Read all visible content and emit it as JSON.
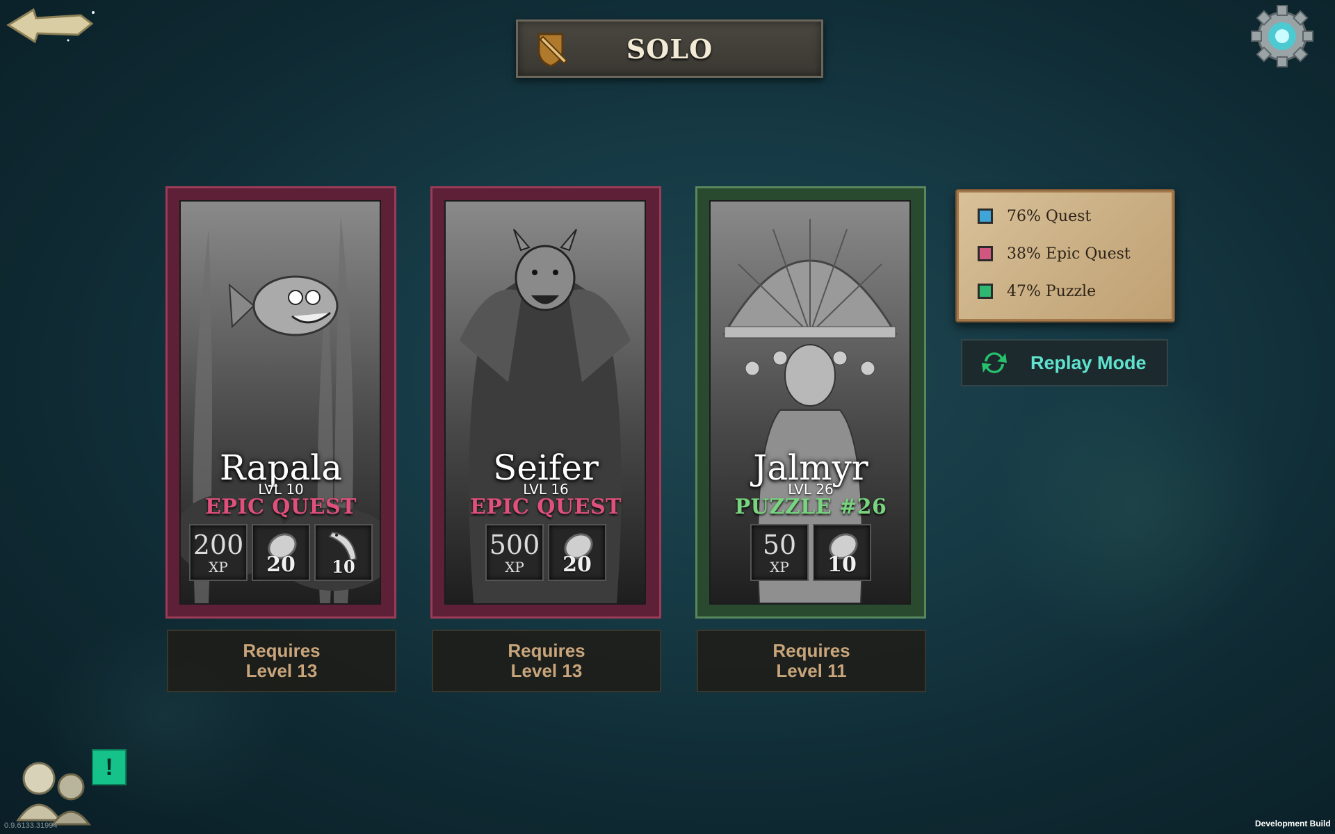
{
  "header": {
    "title": "SOLO"
  },
  "cards": [
    {
      "name": "Rapala",
      "level": "LVL 10",
      "type": "EPIC QUEST",
      "rewards": [
        {
          "value": "200",
          "unit": "XP",
          "icon": "xp-icon"
        },
        {
          "value": "20",
          "icon": "silver-coin-icon"
        },
        {
          "value": "10",
          "icon": "fish-trophy-icon"
        }
      ],
      "requirement_line1": "Requires",
      "requirement_line2": "Level 13"
    },
    {
      "name": "Seifer",
      "level": "LVL 16",
      "type": "EPIC QUEST",
      "rewards": [
        {
          "value": "500",
          "unit": "XP",
          "icon": "xp-icon"
        },
        {
          "value": "20",
          "icon": "silver-coin-icon"
        }
      ],
      "requirement_line1": "Requires",
      "requirement_line2": "Level 13"
    },
    {
      "name": "Jalmyr",
      "level": "LVL 26",
      "type": "PUZZLE #26",
      "rewards": [
        {
          "value": "50",
          "unit": "XP",
          "icon": "xp-icon"
        },
        {
          "value": "10",
          "icon": "silver-coin-icon"
        }
      ],
      "requirement_line1": "Requires",
      "requirement_line2": "Level 11"
    }
  ],
  "legend": [
    {
      "label": "76% Quest",
      "color": "#3fa4d8"
    },
    {
      "label": "38% Epic Quest",
      "color": "#d2577e"
    },
    {
      "label": "47% Puzzle",
      "color": "#2fb872"
    }
  ],
  "replay": {
    "label": "Replay Mode"
  },
  "notification": {
    "symbol": "!"
  },
  "footer": {
    "version": "0.9.6133.31994",
    "build": "Development Build"
  },
  "colors": {
    "epic": "#e0507d",
    "puzzle": "#78d47e",
    "replay": "#5fe3cf"
  }
}
